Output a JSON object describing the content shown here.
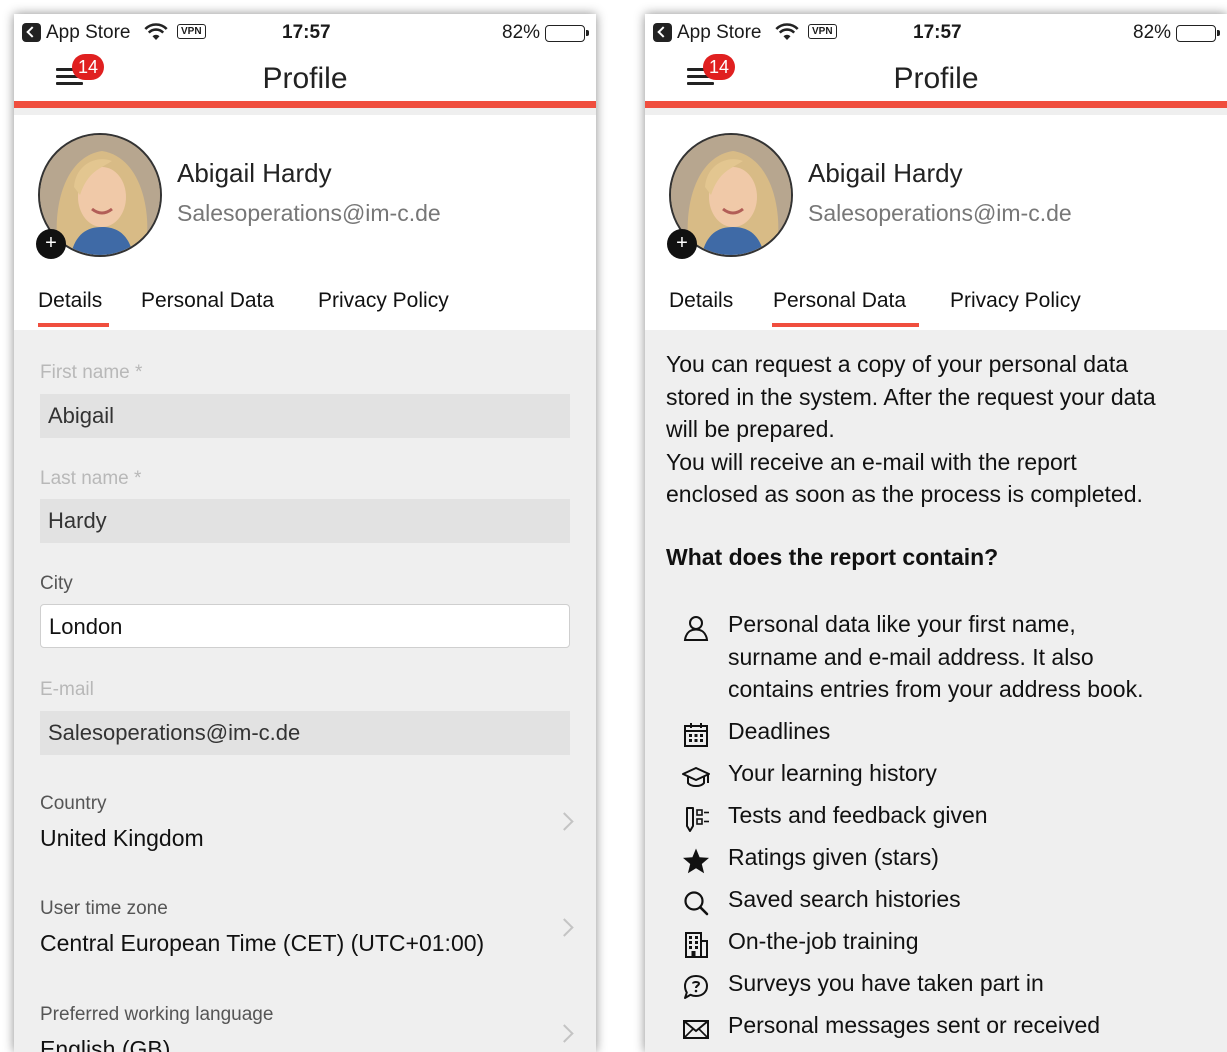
{
  "status_bar": {
    "app": "App Store",
    "vpn": "VPN",
    "time": "17:57",
    "battery": "82%",
    "battery_level": 0.82
  },
  "header": {
    "title": "Profile",
    "badge": "14"
  },
  "profile": {
    "name": "Abigail Hardy",
    "email": "Salesoperations@im-c.de",
    "add_photo": "+"
  },
  "tabs": [
    "Details",
    "Personal Data",
    "Privacy Policy"
  ],
  "details": {
    "first_name": {
      "label": "First name *",
      "value": "Abigail"
    },
    "last_name": {
      "label": "Last name *",
      "value": "Hardy"
    },
    "city": {
      "label": "City",
      "value": "London"
    },
    "email": {
      "label": "E-mail",
      "value": "Salesoperations@im-c.de"
    },
    "country": {
      "label": "Country",
      "value": "United Kingdom"
    },
    "time_zone": {
      "label": "User time zone",
      "value": "Central European Time (CET) (UTC+01:00)"
    },
    "language": {
      "label": "Preferred working language",
      "value": "English (GB)"
    }
  },
  "personal_data": {
    "intro_lines": [
      "You can request a copy of your personal data",
      "stored in the system. After the request your data",
      "will be prepared.",
      "You will receive an e-mail with the report",
      "enclosed as soon as the process is completed."
    ],
    "heading": "What does the report contain?",
    "items": [
      {
        "icon": "person-icon",
        "lines": [
          "Personal data like your first name,",
          "surname and e-mail address. It also",
          "contains entries from your address book."
        ]
      },
      {
        "icon": "calendar-icon",
        "lines": [
          "Deadlines"
        ]
      },
      {
        "icon": "graduation-cap-icon",
        "lines": [
          "Your learning history"
        ]
      },
      {
        "icon": "test-checklist-icon",
        "lines": [
          "Tests and feedback given"
        ]
      },
      {
        "icon": "star-icon",
        "lines": [
          "Ratings given (stars)"
        ]
      },
      {
        "icon": "search-icon",
        "lines": [
          "Saved search histories"
        ]
      },
      {
        "icon": "building-icon",
        "lines": [
          "On-the-job training"
        ]
      },
      {
        "icon": "survey-bubble-icon",
        "lines": [
          "Surveys you have taken part in"
        ]
      },
      {
        "icon": "envelope-icon",
        "lines": [
          "Personal messages sent or received"
        ]
      }
    ]
  },
  "colors": {
    "accent": "#f04e3e",
    "badge": "#e02020"
  }
}
